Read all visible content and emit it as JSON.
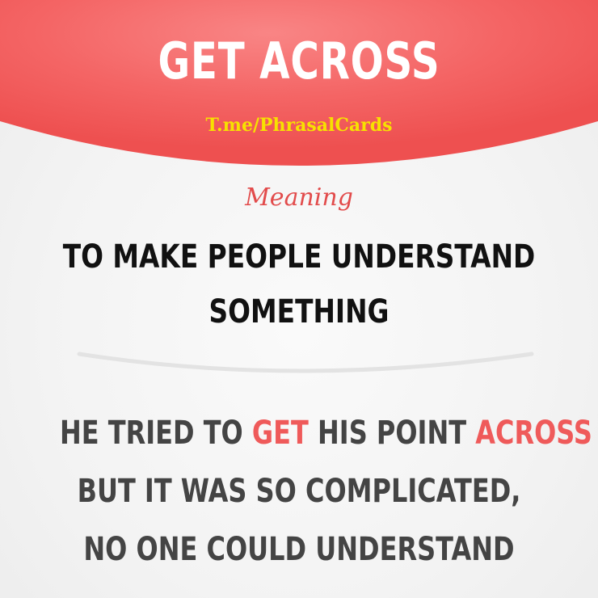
{
  "card": {
    "title": "GET ACROSS",
    "watermark": "T.me/PhrasalCards",
    "meaning_label": "Meaning",
    "definition_lines": [
      "TO MAKE PEOPLE UNDERSTAND",
      "SOMETHING"
    ],
    "example": {
      "line1_part1": "HE TRIED TO ",
      "line1_hl1": "GET",
      "line1_part2": " HIS POINT ",
      "line1_hl2": "ACROSS",
      "line2": "BUT IT WAS SO COMPLICATED,",
      "line3": "NO ONE COULD UNDERSTAND"
    }
  },
  "colors": {
    "header_red": "#f25757",
    "accent_red": "#ef5a5a",
    "watermark_yellow": "#f7e100",
    "definition_text": "#111111",
    "example_text": "#444444",
    "background": "#f4f4f4"
  }
}
